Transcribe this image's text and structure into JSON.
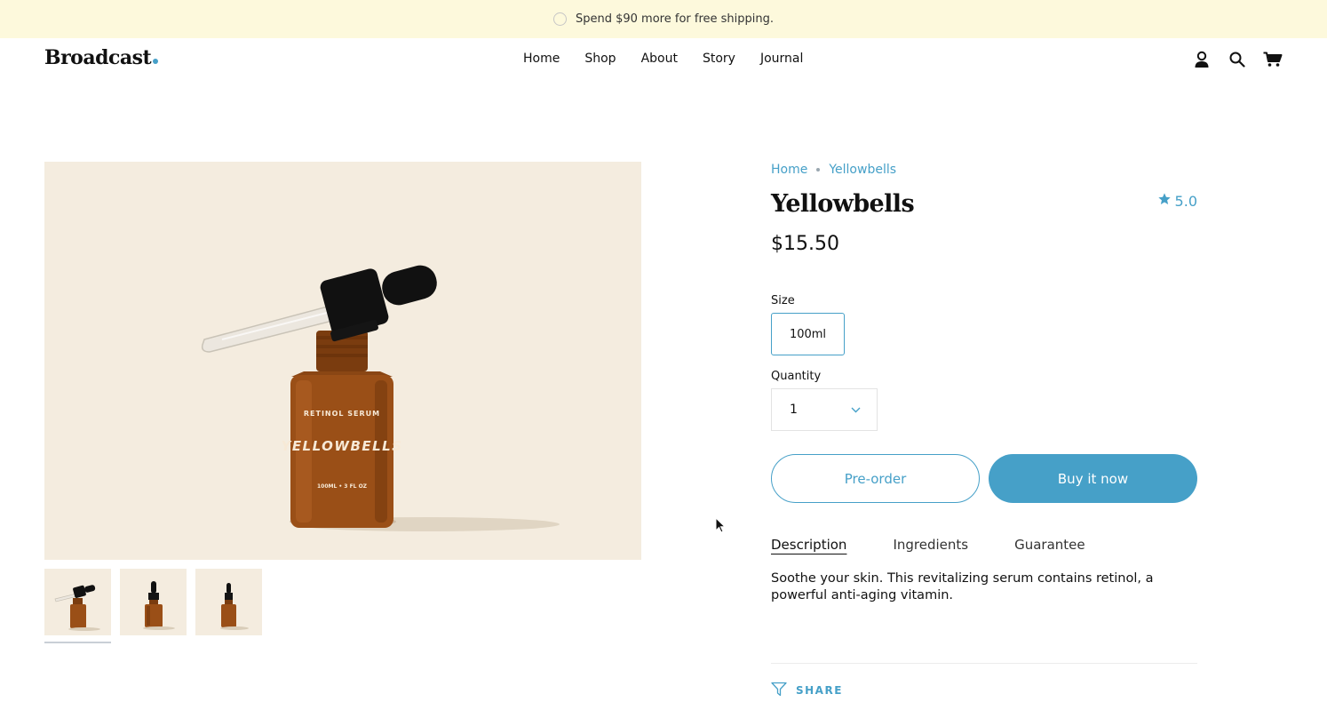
{
  "announcement": {
    "text": "Spend $90 more for free shipping."
  },
  "header": {
    "logo": "Broadcast",
    "nav": [
      "Home",
      "Shop",
      "About",
      "Story",
      "Journal"
    ],
    "icons": [
      "account-icon",
      "search-icon",
      "cart-icon"
    ]
  },
  "gallery": {
    "thumbnail_count": 3,
    "active_thumbnail": 0,
    "label_lines": [
      "RETINOL SERUM",
      "YELLOWBELLS",
      "100ML • 3 FL OZ"
    ]
  },
  "product": {
    "breadcrumb": [
      "Home",
      "Yellowbells"
    ],
    "title": "Yellowbells",
    "rating": "5.0",
    "price": "$15.50",
    "size_label": "Size",
    "size_value": "100ml",
    "quantity_label": "Quantity",
    "quantity_value": "1",
    "preorder_label": "Pre-order",
    "buy_label": "Buy it now",
    "tabs": [
      "Description",
      "Ingredients",
      "Guarantee"
    ],
    "active_tab": "Description",
    "description": "Soothe your skin. This revitalizing serum contains retinol, a powerful anti-aging vitamin.",
    "share_label": "SHARE"
  },
  "colors": {
    "accent": "#46a0c8",
    "announcement_bg": "#fdf9dc",
    "image_bg": "#f4ecdf"
  }
}
